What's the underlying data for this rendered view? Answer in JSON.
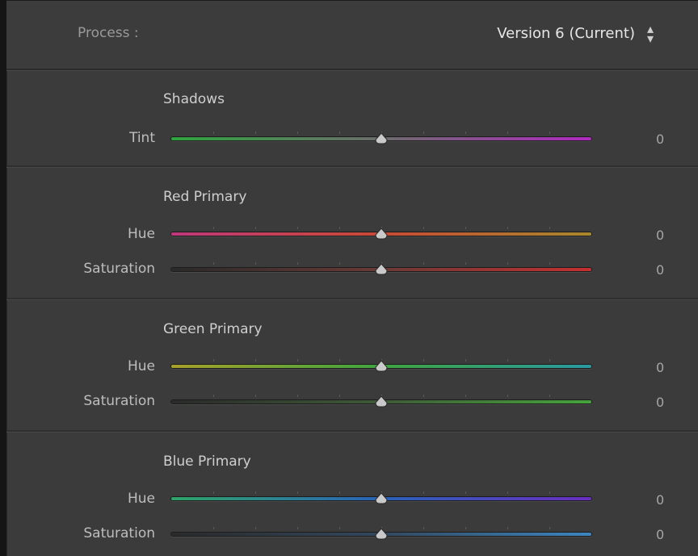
{
  "process": {
    "label": "Process :",
    "value": "Version 6 (Current)",
    "arrows_icon": "up-down-arrows-icon"
  },
  "sections": [
    {
      "title": "Shadows",
      "rows": [
        {
          "label": "Tint",
          "value": "0",
          "slider_fraction": 0.5,
          "gradient": [
            "#2fa43f",
            "#6c6c6c",
            "#b02ac0"
          ]
        }
      ]
    },
    {
      "title": "Red Primary",
      "rows": [
        {
          "label": "Hue",
          "value": "0",
          "slider_fraction": 0.5,
          "gradient": [
            "#c0387b",
            "#c84a35",
            "#a8882c"
          ]
        },
        {
          "label": "Saturation",
          "value": "0",
          "slider_fraction": 0.5,
          "gradient": [
            "#2a2a2a",
            "#6b3a36",
            "#c53030"
          ]
        }
      ]
    },
    {
      "title": "Green Primary",
      "rows": [
        {
          "label": "Hue",
          "value": "0",
          "slider_fraction": 0.5,
          "gradient": [
            "#a7a12a",
            "#3fa540",
            "#2a9aa2"
          ]
        },
        {
          "label": "Saturation",
          "value": "0",
          "slider_fraction": 0.5,
          "gradient": [
            "#2a2a2a",
            "#3f5a38",
            "#46a33c"
          ]
        }
      ]
    },
    {
      "title": "Blue Primary",
      "rows": [
        {
          "label": "Hue",
          "value": "0",
          "slider_fraction": 0.5,
          "gradient": [
            "#2fa468",
            "#2a62b8",
            "#6a2ec0"
          ]
        },
        {
          "label": "Saturation",
          "value": "0",
          "slider_fraction": 0.5,
          "gradient": [
            "#2a2a2a",
            "#33485e",
            "#3d86c0"
          ]
        }
      ]
    }
  ]
}
